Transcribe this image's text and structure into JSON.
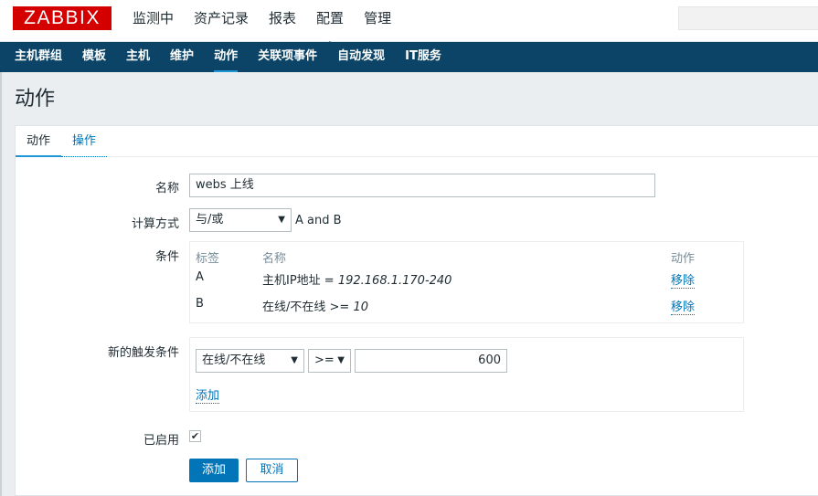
{
  "logo": "ZABBIX",
  "main_menu": [
    "监测中",
    "资产记录",
    "报表",
    "配置",
    "管理"
  ],
  "main_menu_selected": 3,
  "sub_menu": [
    "主机群组",
    "模板",
    "主机",
    "维护",
    "动作",
    "关联项事件",
    "自动发现",
    "IT服务"
  ],
  "sub_menu_selected": 4,
  "page_title": "动作",
  "tabs": {
    "action": "动作",
    "operations": "操作"
  },
  "form": {
    "name_label": "名称",
    "name_value": "webs 上线",
    "calc_label": "计算方式",
    "calc_value": "与/或",
    "calc_formula": "A and B",
    "conditions_label": "条件",
    "cond_head_label": "标签",
    "cond_head_name": "名称",
    "cond_head_action": "动作",
    "conditions": [
      {
        "label": "A",
        "name": "主机IP地址 = ",
        "value": "192.168.1.170-240",
        "action": "移除"
      },
      {
        "label": "B",
        "name": "在线/不在线 >= ",
        "value": "10",
        "action": "移除"
      }
    ],
    "new_cond_label": "新的触发条件",
    "new_cond_type": "在线/不在线",
    "new_cond_operator": ">=",
    "new_cond_value": "600",
    "new_cond_add": "添加",
    "enabled_label": "已启用",
    "enabled": true,
    "add_button": "添加",
    "cancel_button": "取消"
  }
}
